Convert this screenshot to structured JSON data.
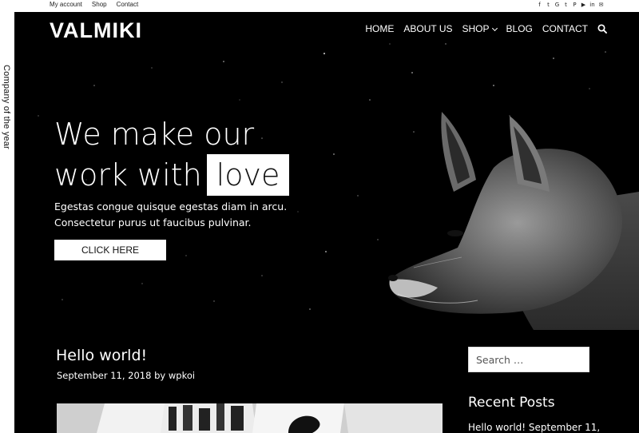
{
  "topbar": {
    "links": [
      "My account",
      "Shop",
      "Contact"
    ],
    "social_icons": [
      "facebook-icon",
      "twitter-icon",
      "google-icon",
      "tumblr-icon",
      "pinterest-icon",
      "youtube-icon",
      "linkedin-icon",
      "email-icon"
    ]
  },
  "side_label": "Company of the year",
  "header": {
    "logo": "VALMIKI",
    "nav": [
      "HOME",
      "ABOUT US",
      "SHOP",
      "BLOG",
      "CONTACT"
    ]
  },
  "hero": {
    "line1": "We make our",
    "line2_prefix": "work with",
    "highlight": "love",
    "sub1": "Egestas congue quisque egestas diam in arcu.",
    "sub2": "Consectetur purus ut faucibus pulvinar.",
    "cta": "CLICK HERE"
  },
  "post": {
    "title": "Hello world!",
    "date": "September 11, 2018",
    "by": "by",
    "author": "wpkoi"
  },
  "sidebar": {
    "search_placeholder": "Search …",
    "recent_title": "Recent Posts",
    "recent_link": "Hello world!",
    "recent_date": "September 11,"
  },
  "colors": {
    "background": "#000000",
    "surface": "#ffffff",
    "text_dark": "#111111"
  }
}
